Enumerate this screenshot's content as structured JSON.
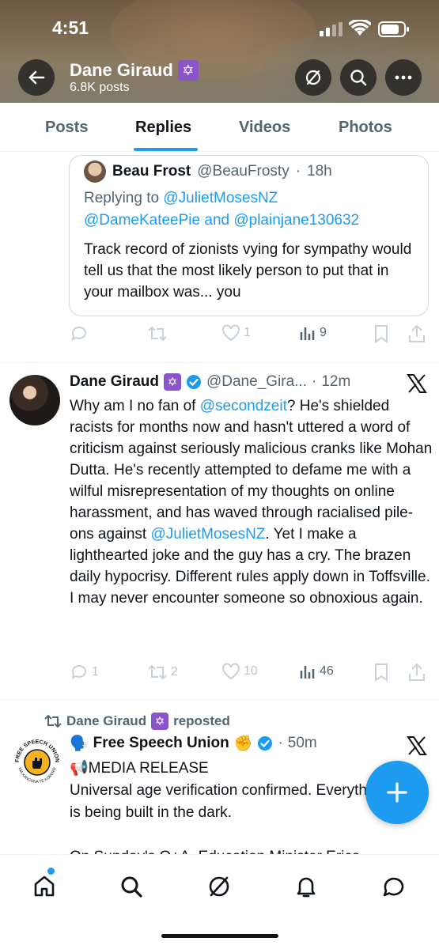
{
  "status_bar": {
    "time": "4:51"
  },
  "profile_header": {
    "name": "Dane Giraud",
    "badge_glyph": "✡",
    "posts_count": "6.8K posts"
  },
  "tabs": [
    {
      "label": "Posts",
      "active": false
    },
    {
      "label": "Replies",
      "active": true
    },
    {
      "label": "Videos",
      "active": false
    },
    {
      "label": "Photos",
      "active": false
    }
  ],
  "quoted_tweet": {
    "name": "Beau Frost",
    "handle": "@BeauFrosty",
    "sep": "·",
    "time": "18h",
    "replying_prefix": "Replying to",
    "replying_user1": "@JulietMosesNZ",
    "replying_user2": "@DameKateePie",
    "replying_and": "and",
    "replying_user3": "@plainjane130632",
    "text": "Track record of zionists vying for sympathy would tell us that the most likely person to put that in your mailbox was... you"
  },
  "quoted_actions": {
    "reply": "",
    "repost": "",
    "like": "1",
    "views": "9"
  },
  "tweet1": {
    "name": "Dane Giraud",
    "handle": "@Dane_Gira...",
    "sep": "·",
    "time": "12m",
    "text_a": "Why am I no fan of ",
    "mention1": "@secondzeit",
    "text_b": "? He's shielded racists for months now and hasn't uttered a word of criticism against seriously malicious cranks like Mohan Dutta. He's recently attempted to defame me with a wilful misrepresentation of my thoughts on online harassment, and has waved through racialised pile-ons against ",
    "mention2": "@JulietMosesNZ",
    "text_c": ". Yet I make a lighthearted joke and the guy has a cry. The brazen daily hypocrisy. Different rules apply down in Toffsville. I may never encounter someone so obnoxious again.",
    "actions": {
      "reply": "1",
      "repost": "2",
      "like": "10",
      "views": "46"
    }
  },
  "repost_line": {
    "name": "Dane Giraud",
    "suffix": "reposted"
  },
  "tweet2": {
    "name": "Free Speech Union",
    "emoji": "✊",
    "sep": "·",
    "time": "50m",
    "line1_emoji": "🗣️📢",
    "line1": "MEDIA RELEASE",
    "line2": "Universal age verification confirmed. Everything else is being built in the dark.",
    "line3": "On Sunday's Q+A, Education Minister Erica",
    "logo_top_text": "FREE SPEECH UNION",
    "logo_bottom_text": "KIA KANGONA TE KORERO"
  },
  "icons": {
    "back": "back-arrow-icon",
    "grok": "grok-icon",
    "search": "search-icon",
    "more": "more-icon",
    "x": "x-logo-icon",
    "compose": "plus-icon",
    "home": "home-icon",
    "explore": "search-icon",
    "grok_nav": "grok-icon",
    "notifications": "bell-icon",
    "messages": "message-icon"
  },
  "colors": {
    "accent": "#1d9bf0",
    "badge": "#8a55c8",
    "text": "#0f1419",
    "muted": "#536471"
  }
}
